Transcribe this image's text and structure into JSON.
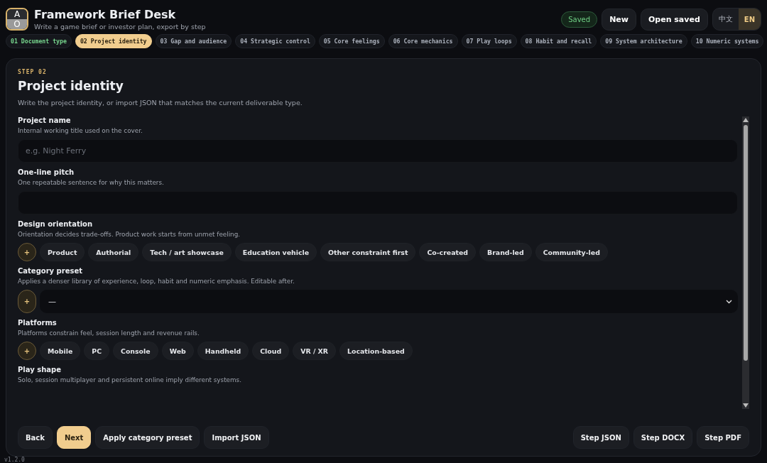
{
  "app": {
    "logo_top": "A",
    "logo_bottom": "O",
    "title": "Framework Brief Desk",
    "subtitle": "Write a game brief or investor plan, export by step"
  },
  "header": {
    "status": "Saved",
    "buttons": [
      "New",
      "Open saved"
    ],
    "languages": [
      {
        "label": "中文",
        "selected": false
      },
      {
        "label": "EN",
        "selected": true
      }
    ]
  },
  "steps": [
    {
      "label": "01 Document type",
      "selected": false,
      "done": true
    },
    {
      "label": "02 Project identity",
      "selected": true,
      "done": false
    },
    {
      "label": "03 Gap and audience",
      "selected": false,
      "done": false
    },
    {
      "label": "04 Strategic control",
      "selected": false,
      "done": false
    },
    {
      "label": "05 Core feelings",
      "selected": false,
      "done": false
    },
    {
      "label": "06 Core mechanics",
      "selected": false,
      "done": false
    },
    {
      "label": "07 Play loops",
      "selected": false,
      "done": false
    },
    {
      "label": "08 Habit and recall",
      "selected": false,
      "done": false
    },
    {
      "label": "09 System architecture",
      "selected": false,
      "done": false
    },
    {
      "label": "10 Numeric systems",
      "selected": false,
      "done": false
    }
  ],
  "page": {
    "eyebrow": "STEP 02",
    "title": "Project identity",
    "description": "Write the project identity, or import JSON that matches the current deliverable type."
  },
  "fields": [
    {
      "kind": "text",
      "label": "Project name",
      "hint": "Internal working title used on the cover.",
      "placeholder": "e.g. Night Ferry"
    },
    {
      "kind": "text",
      "label": "One-line pitch",
      "hint": "One repeatable sentence for why this matters."
    },
    {
      "kind": "chips",
      "label": "Design orientation",
      "hint": "Orientation decides trade-offs. Product work starts from unmet feeling.",
      "add": "+",
      "options": [
        "Product",
        "Authorial",
        "Tech / art showcase",
        "Education vehicle",
        "Other constraint first",
        "Co-created",
        "Brand-led",
        "Community-led"
      ]
    },
    {
      "kind": "select",
      "label": "Category preset",
      "hint": "Applies a denser library of experience, loop, habit and numeric emphasis. Editable after.",
      "add": "+",
      "value": "—"
    },
    {
      "kind": "chips",
      "label": "Platforms",
      "hint": "Platforms constrain feel, session length and revenue rails.",
      "add": "+",
      "options": [
        "Mobile",
        "PC",
        "Console",
        "Web",
        "Handheld",
        "Cloud",
        "VR / XR",
        "Location-based"
      ]
    },
    {
      "kind": "none",
      "label": "Play shape",
      "hint": "Solo, session multiplayer and persistent online imply different systems."
    }
  ],
  "footer": {
    "left": [
      {
        "label": "Back",
        "primary": false
      },
      {
        "label": "Next",
        "primary": true
      },
      {
        "label": "Apply category preset",
        "primary": false
      },
      {
        "label": "Import JSON",
        "primary": false
      }
    ],
    "right": [
      "Step JSON",
      "Step DOCX",
      "Step PDF"
    ]
  },
  "version": "v1.2.0"
}
